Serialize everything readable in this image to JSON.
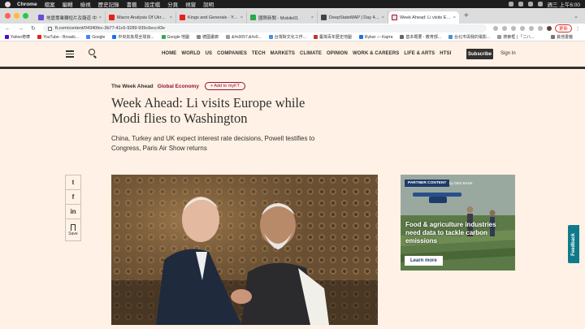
{
  "menubar": {
    "items": [
      "Chrome",
      "檔案",
      "編輯",
      "檢視",
      "歷史記錄",
      "書籤",
      "設定檔",
      "分頁",
      "視窗",
      "說明"
    ],
    "clock": "週三 上午6:00"
  },
  "tabs": [
    {
      "title": "地震專業轉短片及報道 中",
      "color": "#6b4bd8"
    },
    {
      "title": "Macro Analysis Of Ukraine's Sit",
      "color": "#e62117"
    },
    {
      "title": "Kings and Generals - YouTube",
      "color": "#e62117"
    },
    {
      "title": "國際新聞 - Mobile01",
      "color": "#2aa84a"
    },
    {
      "title": "DeepStateMAP | Day 481 | Map",
      "color": "#444444"
    },
    {
      "title": "Week Ahead: Li visits Europe w",
      "color": "#f2dfce",
      "active": true
    }
  ],
  "toolbar": {
    "url": "ft.com/content/04340fec-3b77-41c6-9289-939c6ecc43e",
    "update_label": "更新"
  },
  "bookmarks": [
    {
      "label": "Yahoo奇摩",
      "color": "#6001d2"
    },
    {
      "label": "YouTube - Broadc...",
      "color": "#e62117"
    },
    {
      "label": "Google",
      "color": "#4285f4"
    },
    {
      "label": "中央氣象局全球資...",
      "color": "#1a73e8"
    },
    {
      "label": "Google 地圖",
      "color": "#34a853"
    },
    {
      "label": "德國畫廊",
      "color": "#888888"
    },
    {
      "label": "&#x0057;&#x0...",
      "color": "#999999"
    },
    {
      "label": "台灣對文化工作...",
      "color": "#4a90d9"
    },
    {
      "label": "臺灣百年歷史地圖",
      "color": "#c0392b"
    },
    {
      "label": "Rybar — Карта",
      "color": "#1a73e8"
    },
    {
      "label": "基本概要 - 教育部...",
      "color": "#666666"
    },
    {
      "label": "台北市與我的電影...",
      "color": "#4a90d9"
    },
    {
      "label": "搜索框 | 「二八...",
      "color": "#999999"
    }
  ],
  "bookmarks_other": "其他書籤",
  "ft": {
    "nav": [
      "HOME",
      "WORLD",
      "US",
      "COMPANIES",
      "TECH",
      "MARKETS",
      "CLIMATE",
      "OPINION",
      "WORK & CAREERS",
      "LIFE & ARTS",
      "HTSI"
    ],
    "subscribe": "Subscribe",
    "signin": "Sign In"
  },
  "article": {
    "series": "The Week Ahead",
    "topic": "Global Economy",
    "add_myft": "+ Add to myFT",
    "headline": "Week Ahead: Li visits Europe while Modi flies to Washington",
    "standfirst": "China, Turkey and UK expect interest rate decisions, Powell testifies to Congress, Paris Air Show returns"
  },
  "share": {
    "twitter": "t",
    "facebook": "f",
    "linkedin": "in",
    "save": "Save"
  },
  "partner": {
    "badge": "PARTNER CONTENT",
    "by": "by DBS BANK",
    "title": "Food & agriculture industries need data to tackle carbon emissions",
    "cta": "Learn more"
  },
  "feedback": "Feedback",
  "colors": {
    "ft_pink": "#fff1e5",
    "ft_claret": "#990f3d",
    "ft_dark": "#33302e",
    "feedback_teal": "#0f7b8a"
  }
}
